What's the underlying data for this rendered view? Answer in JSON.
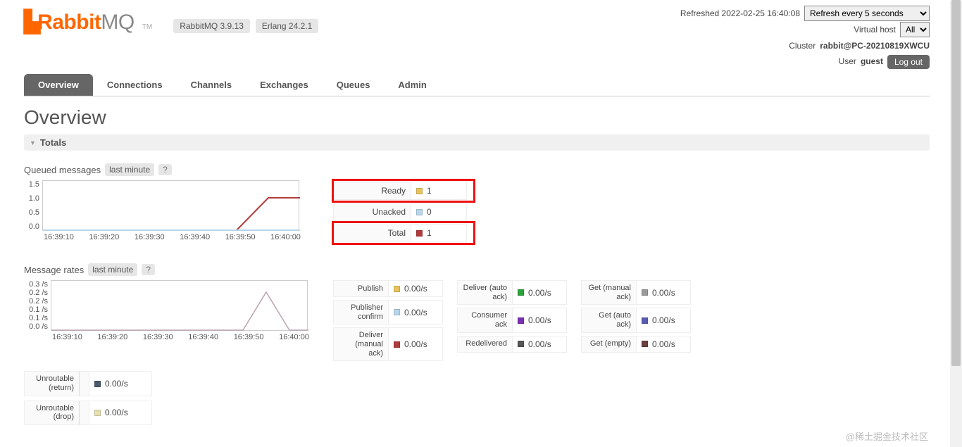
{
  "header": {
    "logo_rabbit": "Rabbit",
    "logo_mq": "MQ",
    "logo_tm": "TM",
    "version_pill": "RabbitMQ 3.9.13",
    "erlang_pill": "Erlang 24.2.1",
    "refreshed": "Refreshed 2022-02-25 16:40:08",
    "refresh_select": "Refresh every 5 seconds",
    "vhost_label": "Virtual host",
    "vhost_value": "All",
    "cluster_label": "Cluster",
    "cluster_value": "rabbit@PC-20210819XWCU",
    "user_label": "User",
    "user_value": "guest",
    "logout": "Log out"
  },
  "nav": {
    "items": [
      "Overview",
      "Connections",
      "Channels",
      "Exchanges",
      "Queues",
      "Admin"
    ],
    "active_index": 0
  },
  "page": {
    "title": "Overview",
    "totals_label": "Totals"
  },
  "queued": {
    "heading": "Queued messages",
    "period": "last minute",
    "help": "?",
    "yticks": [
      "1.5",
      "1.0",
      "0.5",
      "0.0"
    ],
    "xticks": [
      "16:39:10",
      "16:39:20",
      "16:39:30",
      "16:39:40",
      "16:39:50",
      "16:40:00"
    ],
    "legend": [
      {
        "label": "Ready",
        "value": "1",
        "color": "#e8c45a"
      },
      {
        "label": "Unacked",
        "value": "0",
        "color": "#b7d6ec"
      },
      {
        "label": "Total",
        "value": "1",
        "color": "#b23a3a"
      }
    ]
  },
  "rates": {
    "heading": "Message rates",
    "period": "last minute",
    "help": "?",
    "yticks": [
      "0.3 /s",
      "0.2 /s",
      "0.2 /s",
      "0.1 /s",
      "0.1 /s",
      "0.0 /s"
    ],
    "xticks": [
      "16:39:10",
      "16:39:20",
      "16:39:30",
      "16:39:40",
      "16:39:50",
      "16:40:00"
    ],
    "cols": [
      [
        {
          "label": "Publish",
          "value": "0.00/s",
          "color": "#e8c45a"
        },
        {
          "label": "Publisher confirm",
          "value": "0.00/s",
          "color": "#b7d6ec"
        },
        {
          "label": "Deliver (manual ack)",
          "value": "0.00/s",
          "color": "#b23a3a"
        }
      ],
      [
        {
          "label": "Deliver (auto ack)",
          "value": "0.00/s",
          "color": "#2aa33a"
        },
        {
          "label": "Consumer ack",
          "value": "0.00/s",
          "color": "#7a2fb3"
        },
        {
          "label": "Redelivered",
          "value": "0.00/s",
          "color": "#555555"
        }
      ],
      [
        {
          "label": "Get (manual ack)",
          "value": "0.00/s",
          "color": "#9a9a9a"
        },
        {
          "label": "Get (auto ack)",
          "value": "0.00/s",
          "color": "#5b5bb3"
        },
        {
          "label": "Get (empty)",
          "value": "0.00/s",
          "color": "#6b3f3f"
        }
      ]
    ]
  },
  "bottom": [
    {
      "label": "Unroutable (return)",
      "value": "0.00/s",
      "color": "#4a5a6a"
    },
    {
      "label": "Unroutable (drop)",
      "value": "0.00/s",
      "color": "#e6e0b0"
    }
  ],
  "watermark": "@稀土掘金技术社区",
  "chart_data": [
    {
      "type": "line",
      "title": "Queued messages (last minute)",
      "xlabel": "",
      "ylabel": "",
      "x": [
        "16:39:10",
        "16:39:20",
        "16:39:30",
        "16:39:40",
        "16:39:50",
        "16:40:00"
      ],
      "ylim": [
        0,
        1.5
      ],
      "series": [
        {
          "name": "Ready",
          "values": [
            0,
            0,
            0,
            0,
            0,
            1
          ]
        },
        {
          "name": "Unacked",
          "values": [
            0,
            0,
            0,
            0,
            0,
            0
          ]
        },
        {
          "name": "Total",
          "values": [
            0,
            0,
            0,
            0,
            0,
            1
          ]
        }
      ]
    },
    {
      "type": "line",
      "title": "Message rates (last minute)",
      "xlabel": "",
      "ylabel": "/s",
      "x": [
        "16:39:10",
        "16:39:20",
        "16:39:30",
        "16:39:40",
        "16:39:50",
        "16:40:00"
      ],
      "ylim": [
        0,
        0.3
      ],
      "series": [
        {
          "name": "Publish",
          "values": [
            0,
            0,
            0,
            0,
            0.2,
            0
          ]
        },
        {
          "name": "Publisher confirm",
          "values": [
            0,
            0,
            0,
            0,
            0,
            0
          ]
        },
        {
          "name": "Deliver (manual ack)",
          "values": [
            0,
            0,
            0,
            0,
            0,
            0
          ]
        },
        {
          "name": "Deliver (auto ack)",
          "values": [
            0,
            0,
            0,
            0,
            0,
            0
          ]
        },
        {
          "name": "Consumer ack",
          "values": [
            0,
            0,
            0,
            0,
            0,
            0
          ]
        },
        {
          "name": "Redelivered",
          "values": [
            0,
            0,
            0,
            0,
            0,
            0
          ]
        },
        {
          "name": "Get (manual ack)",
          "values": [
            0,
            0,
            0,
            0,
            0,
            0
          ]
        },
        {
          "name": "Get (auto ack)",
          "values": [
            0,
            0,
            0,
            0,
            0,
            0
          ]
        },
        {
          "name": "Get (empty)",
          "values": [
            0,
            0,
            0,
            0,
            0,
            0
          ]
        }
      ]
    }
  ]
}
